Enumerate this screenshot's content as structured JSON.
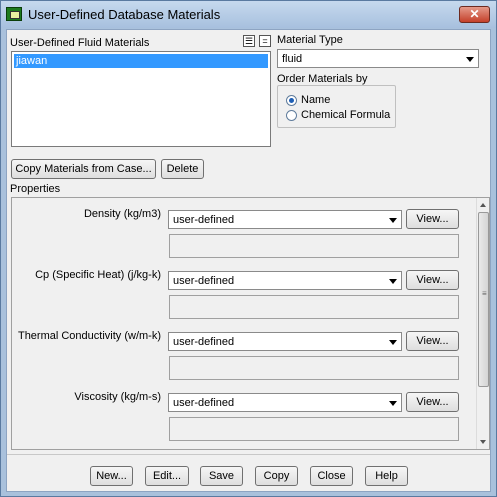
{
  "window": {
    "title": "User-Defined Database Materials",
    "close_glyph": "✕"
  },
  "fluid_list": {
    "label": "User-Defined Fluid Materials",
    "items": [
      "jiawan"
    ],
    "select_all_glyph": "☰",
    "deselect_all_glyph": "="
  },
  "material_type": {
    "label": "Material Type",
    "value": "fluid"
  },
  "order_by": {
    "label": "Order Materials by",
    "options": [
      "Name",
      "Chemical Formula"
    ],
    "selected": "Name"
  },
  "actions": {
    "copy_from_case": "Copy Materials from Case...",
    "delete": "Delete"
  },
  "properties": {
    "label": "Properties",
    "rows": [
      {
        "label": "Density (kg/m3)",
        "method": "user-defined",
        "view": "View..."
      },
      {
        "label": "Cp (Specific Heat) (j/kg-k)",
        "method": "user-defined",
        "view": "View..."
      },
      {
        "label": "Thermal Conductivity (w/m-k)",
        "method": "user-defined",
        "view": "View..."
      },
      {
        "label": "Viscosity (kg/m-s)",
        "method": "user-defined",
        "view": "View..."
      }
    ]
  },
  "footer": {
    "new": "New...",
    "edit": "Edit...",
    "save": "Save",
    "copy": "Copy",
    "close": "Close",
    "help": "Help"
  },
  "colors": {
    "selection": "#3399ff",
    "titlebar": "#a7c0de",
    "close": "#c4402a"
  }
}
